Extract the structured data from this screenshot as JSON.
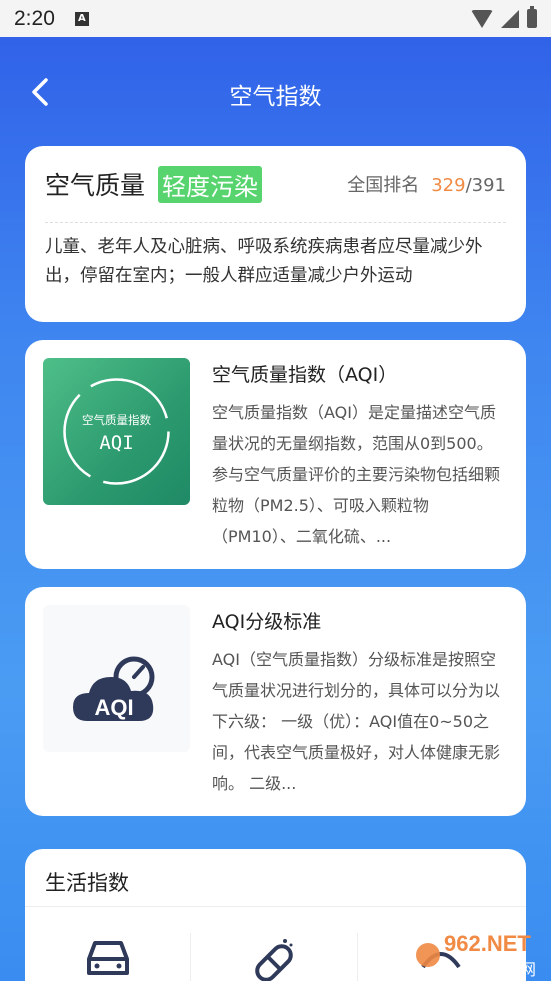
{
  "status_bar": {
    "time": "2:20",
    "notif_letter": "A"
  },
  "nav": {
    "title": "空气指数"
  },
  "air_quality": {
    "label": "空气质量",
    "level": "轻度污染",
    "level_color": "#58d46f",
    "rank_label": "全国排名",
    "rank": "329",
    "rank_total": "/391",
    "rank_color": "#f08a44",
    "advice": "儿童、老年人及心脏病、呼吸系统疾病患者应尽量减少外出，停留在室内；一般人群应适量减少户外运动"
  },
  "articles": [
    {
      "title": "空气质量指数（AQI）",
      "text": "空气质量指数（AQI）是定量描述空气质量状况的无量纲指数，范围从0到500。参与空气质量评价的主要污染物包括细颗粒物（PM2.5）、可吸入颗粒物（PM10）、二氧化硫、...",
      "thumb_line1": "空气质量指数",
      "thumb_line2": "AQI"
    },
    {
      "title": "AQI分级标准",
      "text": "AQI（空气质量指数）分级标准是按照空气质量状况进行划分的，具体可以分为以下六级： 一级（优）：AQI值在0~50之间，代表空气质量极好，对人体健康无影响。 二级...",
      "thumb_label": "AQI"
    }
  ],
  "life": {
    "title": "生活指数"
  },
  "watermark": {
    "brand": "962.NET",
    "sub": "乐游网"
  },
  "colors": {
    "accent_blue": "#2f5ee8",
    "dark_navy": "#2f3a5a"
  }
}
